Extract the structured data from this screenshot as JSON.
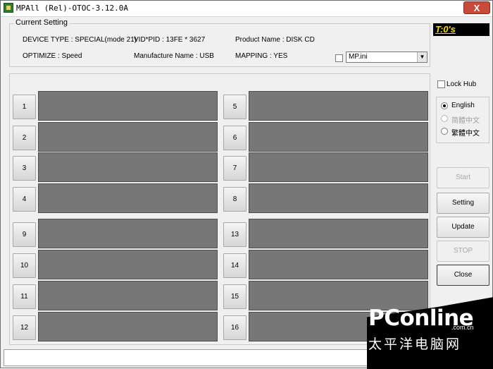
{
  "window": {
    "title": "MPAll (Rel)-OTOC-3.12.0A",
    "close_glyph": "X"
  },
  "current_setting": {
    "title": "Current Setting",
    "device_type": "DEVICE TYPE : SPECIAL(mode 21)",
    "vid_pid": "VID*PID : 13FE * 3627",
    "product_name": "Product Name : DISK CD",
    "optimize": "OPTIMIZE : Speed",
    "manufacture_name": "Manufacture Name : USB",
    "mapping": "MAPPING : YES",
    "ini_file": "MP.ini"
  },
  "timer": "T:0's",
  "ports": [
    "1",
    "2",
    "3",
    "4",
    "5",
    "6",
    "7",
    "8",
    "9",
    "10",
    "11",
    "12",
    "13",
    "14",
    "15",
    "16"
  ],
  "lock_hub": {
    "label": "Lock Hub",
    "checked": false
  },
  "languages": [
    {
      "label": "English",
      "selected": true,
      "enabled": true
    },
    {
      "label": "简體中文",
      "selected": false,
      "enabled": false
    },
    {
      "label": "繁體中文",
      "selected": false,
      "enabled": true
    }
  ],
  "buttons": {
    "start": "Start",
    "setting": "Setting",
    "update": "Update",
    "stop": "STOP",
    "close": "Close"
  },
  "watermark": {
    "brand": "PConline",
    "domain": ".com.cn",
    "cn": "太平洋电脑网"
  },
  "colors": {
    "port_panel": "#777777",
    "timer_text": "#f4dc1b",
    "timer_bg": "#000000"
  }
}
